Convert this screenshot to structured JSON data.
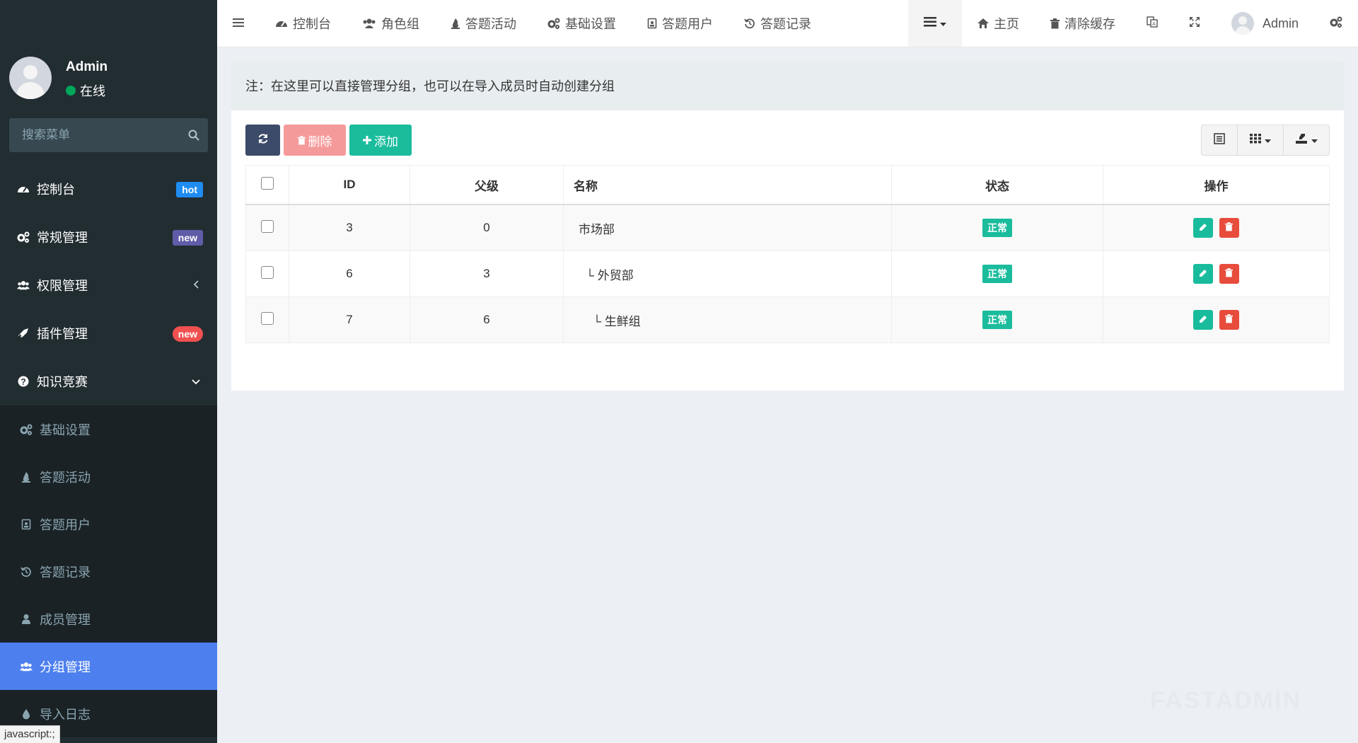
{
  "sidebar": {
    "user": {
      "name": "Admin",
      "status": "在线"
    },
    "search_placeholder": "搜索菜单",
    "items": [
      {
        "label": "控制台",
        "badge": "hot"
      },
      {
        "label": "常规管理",
        "badge": "new"
      },
      {
        "label": "权限管理"
      },
      {
        "label": "插件管理",
        "badge": "new"
      },
      {
        "label": "知识竞赛"
      }
    ],
    "subitems": [
      {
        "label": "基础设置"
      },
      {
        "label": "答题活动"
      },
      {
        "label": "答题用户"
      },
      {
        "label": "答题记录"
      },
      {
        "label": "成员管理"
      },
      {
        "label": "分组管理"
      },
      {
        "label": "导入日志"
      }
    ],
    "status_tip": "javascript:;"
  },
  "topbar": {
    "tabs": [
      {
        "label": "控制台"
      },
      {
        "label": "角色组"
      },
      {
        "label": "答题活动"
      },
      {
        "label": "基础设置"
      },
      {
        "label": "答题用户"
      },
      {
        "label": "答题记录"
      }
    ],
    "home": "主页",
    "clear_cache": "清除缓存",
    "user": "Admin"
  },
  "main": {
    "notice": "注：在这里可以直接管理分组，也可以在导入成员时自动创建分组",
    "toolbar": {
      "delete": "删除",
      "add": "添加"
    },
    "table": {
      "headers": {
        "id": "ID",
        "parent": "父级",
        "name": "名称",
        "status": "状态",
        "ops": "操作"
      },
      "rows": [
        {
          "id": "3",
          "parent": "0",
          "name": "市场部",
          "status": "正常"
        },
        {
          "id": "6",
          "parent": "3",
          "name": "└ 外贸部",
          "status": "正常"
        },
        {
          "id": "7",
          "parent": "6",
          "name": "└ 生鲜组",
          "status": "正常"
        }
      ]
    }
  },
  "watermark": "FASTADMIN",
  "colors": {
    "sidebar": "#222d32",
    "active": "#4d80ee",
    "success": "#1abc9c",
    "danger": "#e74c3c"
  }
}
